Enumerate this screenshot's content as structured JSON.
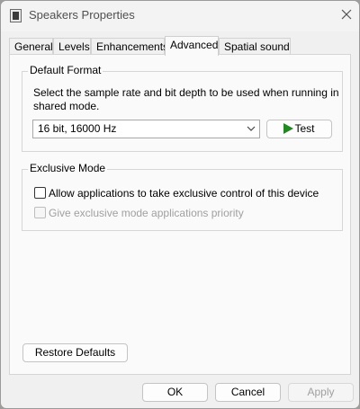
{
  "window": {
    "title": "Speakers Properties",
    "title_icon": "speaker-icon",
    "close_icon": "close-icon"
  },
  "tabs": [
    {
      "label": "General",
      "active": false
    },
    {
      "label": "Levels",
      "active": false
    },
    {
      "label": "Enhancements",
      "active": false
    },
    {
      "label": "Advanced",
      "active": true
    },
    {
      "label": "Spatial sound",
      "active": false
    }
  ],
  "default_format": {
    "legend": "Default Format",
    "description": "Select the sample rate and bit depth to be used when running in shared mode.",
    "selected_value": "16 bit, 16000 Hz",
    "test_label": "Test",
    "test_icon": "play-icon"
  },
  "exclusive_mode": {
    "legend": "Exclusive Mode",
    "allow_label": "Allow applications to take exclusive control of this device",
    "allow_checked": false,
    "priority_label": "Give exclusive mode applications priority",
    "priority_checked": false,
    "priority_enabled": false
  },
  "restore_defaults_label": "Restore Defaults",
  "footer": {
    "ok_label": "OK",
    "cancel_label": "Cancel",
    "apply_label": "Apply"
  },
  "colors": {
    "play_green": "#1f8a1f",
    "disabled_text": "#a0a0a0"
  }
}
